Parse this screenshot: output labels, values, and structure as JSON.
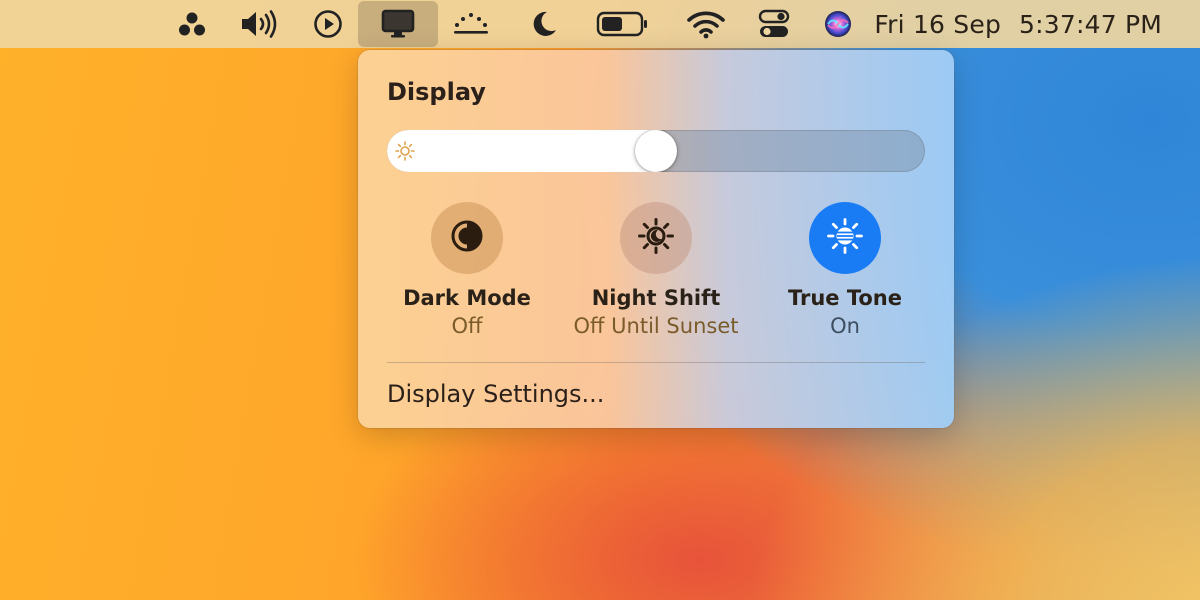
{
  "menubar": {
    "icons": [
      {
        "name": "control-center-dots-icon"
      },
      {
        "name": "volume-icon"
      },
      {
        "name": "now-playing-icon"
      },
      {
        "name": "display-icon"
      },
      {
        "name": "screen-mirroring-icon"
      },
      {
        "name": "focus-moon-icon"
      },
      {
        "name": "battery-icon"
      },
      {
        "name": "wifi-icon"
      },
      {
        "name": "control-center-toggles-icon"
      },
      {
        "name": "siri-icon"
      }
    ],
    "date": "Fri 16 Sep",
    "time": "5:37:47 PM"
  },
  "panel": {
    "title": "Display",
    "brightness": {
      "level_percent": 50,
      "icon": "sun-icon"
    },
    "toggles": [
      {
        "label": "Dark Mode",
        "state": "Off",
        "icon": "dark-mode-icon",
        "active": false
      },
      {
        "label": "Night Shift",
        "state": "Off Until Sunset",
        "icon": "night-shift-icon",
        "active": false
      },
      {
        "label": "True Tone",
        "state": "On",
        "icon": "true-tone-icon",
        "active": true
      }
    ],
    "settings_link": "Display Settings..."
  },
  "colors": {
    "accent_blue": "#1a7cf5",
    "inactive_toggle": "#d6a46a"
  }
}
